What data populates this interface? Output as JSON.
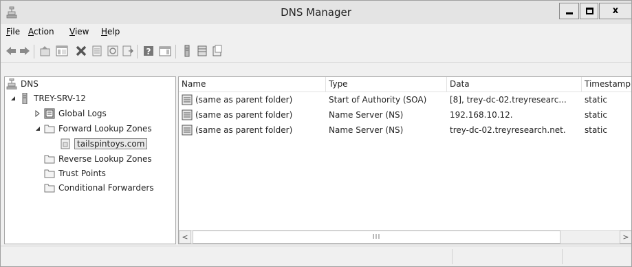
{
  "window": {
    "title": "DNS Manager",
    "controls": {
      "minimize": "minimize",
      "maximize": "maximize",
      "close": "x"
    }
  },
  "menu": {
    "items": [
      {
        "key": "F",
        "rest": "ile"
      },
      {
        "key": "A",
        "rest": "ction"
      },
      {
        "key": "V",
        "rest": "iew"
      },
      {
        "key": "H",
        "rest": "elp"
      }
    ]
  },
  "toolbar": {
    "icons": [
      "back-icon",
      "forward-icon",
      "up-icon",
      "show-hide-tree-icon",
      "delete-icon",
      "properties-icon",
      "refresh-icon",
      "export-icon",
      "help-icon",
      "action-pane-icon",
      "server-icon",
      "zone-icon",
      "record-icon"
    ]
  },
  "tree": {
    "root": "DNS",
    "server": "TREY-SRV-12",
    "global_logs": "Global Logs",
    "forward_zones": "Forward Lookup Zones",
    "selected_zone": "tailspintoys.com",
    "reverse_zones": "Reverse Lookup Zones",
    "trust_points": "Trust Points",
    "conditional_forwarders": "Conditional Forwarders"
  },
  "list": {
    "columns": [
      "Name",
      "Type",
      "Data",
      "Timestamp"
    ],
    "rows": [
      {
        "name": "(same as parent folder)",
        "type": "Start of Authority (SOA)",
        "data": "[8], trey-dc-02.treyresearc...",
        "timestamp": "static"
      },
      {
        "name": "(same as parent folder)",
        "type": "Name Server (NS)",
        "data": "192.168.10.12.",
        "timestamp": "static"
      },
      {
        "name": "(same as parent folder)",
        "type": "Name Server (NS)",
        "data": "trey-dc-02.treyresearch.net.",
        "timestamp": "static"
      }
    ]
  },
  "scrollbar": {
    "left": "<",
    "right": ">",
    "grip": "III"
  }
}
